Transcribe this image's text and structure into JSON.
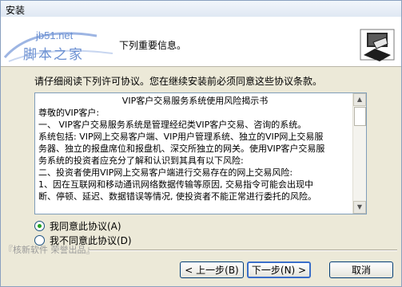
{
  "window": {
    "title": "安装"
  },
  "header": {
    "watermark_url": "jb51.net",
    "watermark_name": "脚本之家",
    "subtitle": "下列重要信息。"
  },
  "instruction": "请仔细阅读下列许可协议。您在继续安装前必须同意这些协议条款。",
  "license": {
    "lines": [
      "VIP客户交易服务系统使用风险揭示书",
      "尊敬的VIP客户:",
      "一、    VIP客户交易服务系统是管理经纪类VIP客户交易、咨询的系统。",
      "系统包括: VIP网上交易客户端、VIP用户管理系统、独立的VIP网上交易服",
      "务器、独立的报盘席位和报盘机、深交所独立的网关。使用VIP客户交易服",
      "务系统的投资者应充分了解和认识到其具有以下风险:",
      "二、投资者使用VIP网上交易客户端进行交易存在的网上交易风险:",
      "1、因在互联网和移动通讯网络数据传输等原因, 交易指令可能会出现中",
      "断、停顿、延迟、数据错误等情况, 使投资者不能正常进行委托的风险。"
    ]
  },
  "radios": {
    "accept": "我同意此协议(A)",
    "decline": "我不同意此协议(D)",
    "selected": "accept"
  },
  "footer": {
    "brand": "『核新软件 荣誉出品』"
  },
  "buttons": {
    "back": "< 上一步(B)",
    "next": "下一步(N) >",
    "cancel": "取消"
  }
}
